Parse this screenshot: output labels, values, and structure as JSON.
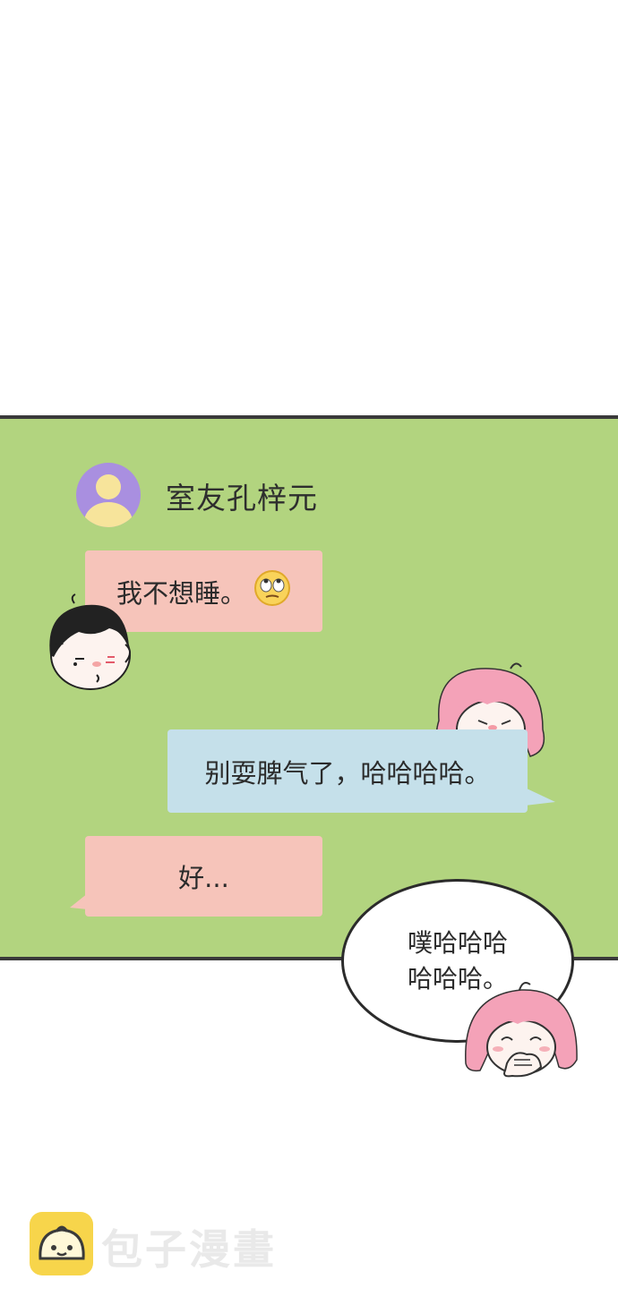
{
  "chat": {
    "contact_name": "室友孔梓元",
    "messages": [
      {
        "sender": "contact",
        "text": "我不想睡。",
        "emoji": "eye-roll-emoji"
      },
      {
        "sender": "me",
        "text": "别耍脾气了，哈哈哈哈。"
      },
      {
        "sender": "contact",
        "text": "好..."
      }
    ]
  },
  "speech_bubble": {
    "line1": "噗哈哈哈",
    "line2": "哈哈哈。"
  },
  "watermark": {
    "text": "包子漫畫"
  },
  "colors": {
    "panel_background": "#b2d47f",
    "contact_bubble": "#f6c4ba",
    "my_bubble": "#c5e0ea",
    "avatar": "#a98fe0",
    "watermark_logo": "#f7d54b"
  }
}
